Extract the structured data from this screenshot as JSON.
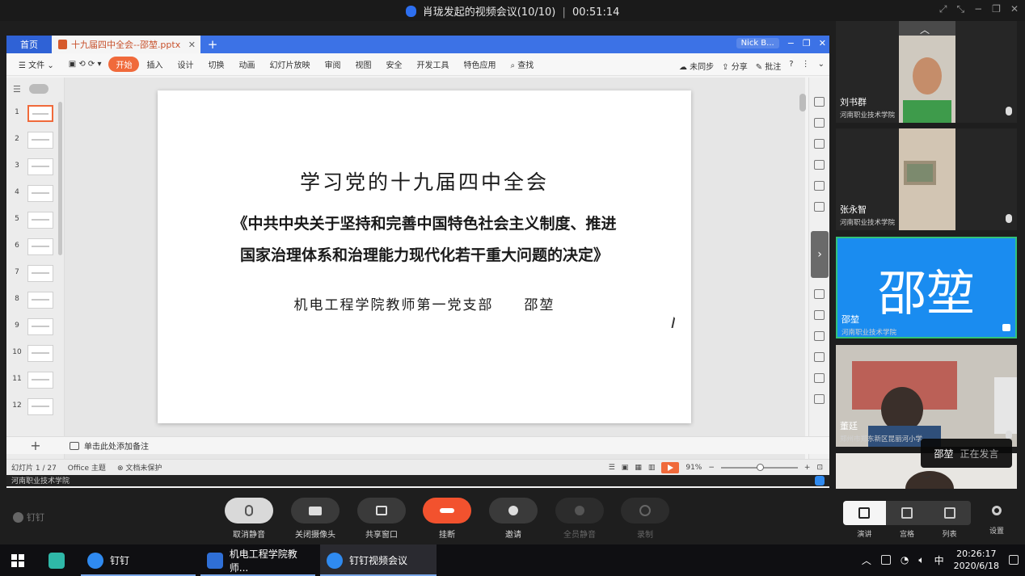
{
  "meeting": {
    "title": "肖珑发起的视频会议(10/10)",
    "duration": "00:51:14"
  },
  "wps": {
    "home_tab": "首页",
    "doc_tab": "十九届四中全会--邵堃.pptx",
    "user_tab": "Nick B...",
    "ribbon": {
      "file": "文件",
      "items": [
        "开始",
        "插入",
        "设计",
        "切换",
        "动画",
        "幻灯片放映",
        "审阅",
        "视图",
        "安全",
        "开发工具",
        "特色应用",
        "查找"
      ],
      "sync": "未同步",
      "share": "分享",
      "comment": "批注"
    },
    "thumbnails": [
      "1",
      "2",
      "3",
      "4",
      "5",
      "6",
      "7",
      "8",
      "9",
      "10",
      "11",
      "12"
    ],
    "slide": {
      "title": "学习党的十九届四中全会",
      "line1": "《中共中央关于坚持和完善中国特色社会主义制度、推进",
      "line2": "国家治理体系和治理能力现代化若干重大问题的决定》",
      "author": "机电工程学院教师第一党支部　　邵堃"
    },
    "notes_placeholder": "单击此处添加备注",
    "status": {
      "page": "幻灯片 1 / 27",
      "theme": "Office 主题",
      "protect": "文档未保护",
      "zoom": "91%"
    },
    "share_footer": "河南职业技术学院"
  },
  "participants": [
    {
      "name": "刘书群",
      "org": "河南职业技术学院"
    },
    {
      "name": "张永智",
      "org": "河南职业技术学院"
    },
    {
      "name": "邵堃",
      "org": "河南职业技术学院",
      "initials": "邵堃"
    },
    {
      "name": "董廷",
      "org": "郑州市郑东新区昆丽河小学"
    }
  ],
  "speaking": {
    "name": "邵堃",
    "status": "正在发言"
  },
  "controls": {
    "brand": "钉钉",
    "items": [
      {
        "label": "取消静音"
      },
      {
        "label": "关闭摄像头"
      },
      {
        "label": "共享窗口"
      },
      {
        "label": "挂断"
      },
      {
        "label": "邀请"
      },
      {
        "label": "全员静音"
      },
      {
        "label": "录制"
      }
    ],
    "layouts": [
      "演讲",
      "宫格",
      "列表"
    ],
    "settings": "设置"
  },
  "taskbar": {
    "apps": [
      "钉钉",
      "机电工程学院教师...",
      "钉钉视频会议"
    ],
    "ime": "中",
    "time": "20:26:17",
    "date": "2020/6/18"
  },
  "colors": {
    "accent": "#3c72e6",
    "active_speaker": "#1a8cf0",
    "hangup": "#f2522e",
    "wps_orange": "#f06a3b"
  }
}
